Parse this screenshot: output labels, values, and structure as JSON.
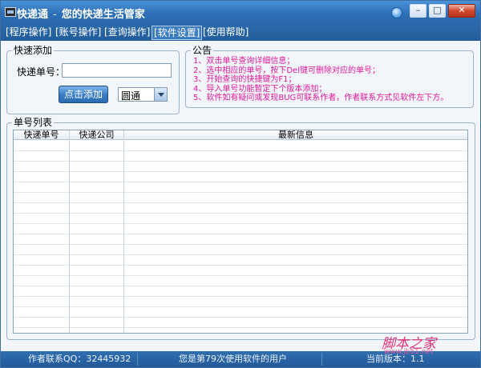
{
  "window": {
    "title": "快递通",
    "subtitle": "您的快递生活管家"
  },
  "menu": [
    {
      "label": "[程序操作]"
    },
    {
      "label": "[账号操作]"
    },
    {
      "label": "[查询操作]"
    },
    {
      "label": "[软件设置]"
    },
    {
      "label": "[使用帮助]"
    }
  ],
  "quick_add": {
    "group_title": "快速添加",
    "tracking_label": "快递单号：",
    "tracking_value": "",
    "add_button": "点击添加",
    "courier_value": "圆通"
  },
  "notice": {
    "group_title": "公告",
    "lines": [
      "1、双击单号查询详细信息；",
      "2、选中相应的单号，按下Del键可删除对应的单号；",
      "3、开始查询的快捷键为F1；",
      "4、导入单号功能暂定下个版本添加；",
      "5、软件如有疑问或发现BUG可联系作者，作者联系方式见软件左下方。"
    ]
  },
  "tracking_list": {
    "group_title": "单号列表",
    "columns": [
      "快递单号",
      "快递公司",
      "最新信息"
    ],
    "rows": []
  },
  "status": {
    "author_qq": "作者联系QQ：32445932",
    "usage": "您是第79次使用软件的用户",
    "version": "当前版本：1.1"
  },
  "watermark": {
    "logo": "脚本之家",
    "url": "www.jb51.net"
  }
}
